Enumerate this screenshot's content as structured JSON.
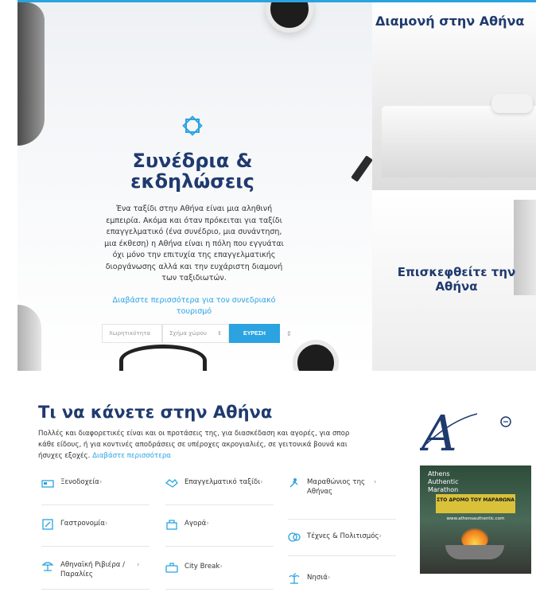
{
  "hero": {
    "title": "Συνέδρια & εκδηλώσεις",
    "description": "Ένα ταξίδι στην Αθήνα είναι μια αληθινή εμπειρία. Ακόμα και όταν πρόκειται για ταξίδι επαγγελματικό (ένα συνέδριο, μια συνάντηση, μια έκθεση) η Αθήνα είναι η πόλη που εγγυάται όχι μόνο την επιτυχία της επαγγελματικής διοργάνωσης αλλά και την ευχάριστη διαμονή των ταξιδιωτών.",
    "link": "Διαβάστε περισσότερα για τον συνεδριακό τουρισμό",
    "search": {
      "location_placeholder": "Χωρητικότητα",
      "type_placeholder": "Σχήμα χώρου",
      "button": "ΕΥΡΕΣΗ"
    },
    "brand_icon": "diamond-logo-icon",
    "accent_color": "#2aa3e0",
    "title_color": "#1f3a6e"
  },
  "panels": {
    "accommodation_title": "Διαμονή στην Αθήνα",
    "visit_title": "Επισκεφθείτε την Αθήνα"
  },
  "section": {
    "title": "Τι να κάνετε στην Αθήνα",
    "description": "Πολλές και διαφορετικές είναι και οι προτάσεις της, για διασκέδαση και αγορές, για σπορ κάθε είδους, ή για κοντινές αποδράσεις σε υπέροχες ακρογιαλιές, σε γειτονικά βουνά και ήσυχες εξοχές.",
    "read_more": "Διαβάστε περισσότερα"
  },
  "categories": [
    {
      "label": "Ξενοδοχεία",
      "icon": "hotel-icon"
    },
    {
      "label": "Επαγγελματικό ταξίδι",
      "icon": "handshake-icon"
    },
    {
      "label": "Μαραθώνιος της Αθήνας",
      "icon": "runner-icon"
    },
    {
      "label": "Γαστρονομία",
      "icon": "menu-icon"
    },
    {
      "label": "Αγορά",
      "icon": "shopping-bag-icon"
    },
    {
      "label": "Τέχνες & Πολιτισμός",
      "icon": "theatre-icon"
    },
    {
      "label": "Αθηναϊκή Ριβιέρα / Παραλίες",
      "icon": "beach-umbrella-icon"
    },
    {
      "label": "City Break",
      "icon": "suitcase-icon"
    },
    {
      "label": "Νησιά",
      "icon": "palm-island-icon"
    }
  ],
  "ads": {
    "logo_line1": "Athens",
    "logo_line2": "Authentic",
    "logo_line3": "Marathon",
    "headline": "ΣΤΟ ΔΡΟΜΟ ΤΟΥ ΜΑΡΑΘΩΝΑ",
    "url": "www.athensauthentic.com"
  }
}
